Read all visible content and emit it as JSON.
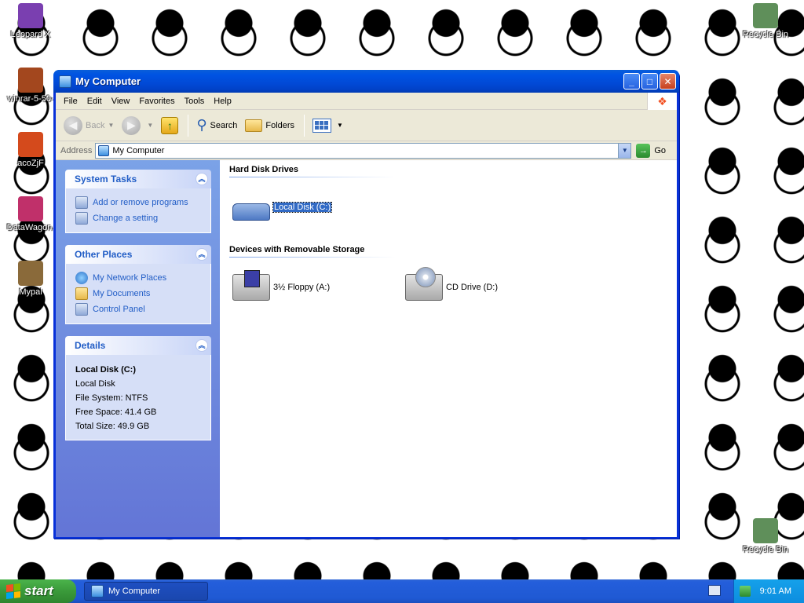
{
  "desktop": {
    "icons": [
      {
        "label": "Leopard X",
        "color": "#7a3fb0"
      },
      {
        "label": "winrar-5-50-",
        "color": "#a3471e"
      },
      {
        "label": "acoZjF",
        "color": "#d44a1c"
      },
      {
        "label": "DataWagon.",
        "color": "#c0306a"
      },
      {
        "label": "Mypal",
        "color": "#8a6a3a"
      },
      {
        "label": "Recycle Bin",
        "color": "#5f8f5a"
      },
      {
        "label": "Recycle Bin",
        "color": "#5f8f5a"
      }
    ]
  },
  "window": {
    "title": "My Computer",
    "buttons": {
      "minimize": "_",
      "maximize": "□",
      "close": "✕"
    },
    "menu": [
      "File",
      "Edit",
      "View",
      "Favorites",
      "Tools",
      "Help"
    ],
    "toolbar": {
      "back": "Back",
      "search": "Search",
      "folders": "Folders"
    },
    "address": {
      "label": "Address",
      "value": "My Computer",
      "go": "Go"
    }
  },
  "taskpane": {
    "system_tasks": {
      "title": "System Tasks",
      "items": [
        "Add or remove programs",
        "Change a setting"
      ]
    },
    "other_places": {
      "title": "Other Places",
      "items": [
        "My Network Places",
        "My Documents",
        "Control Panel"
      ]
    },
    "details": {
      "title": "Details",
      "name": "Local Disk (C:)",
      "type": "Local Disk",
      "file_system": "File System: NTFS",
      "free_space": "Free Space: 41.4 GB",
      "total_size": "Total Size: 49.9 GB"
    }
  },
  "content": {
    "hard_disks": {
      "title": "Hard Disk Drives",
      "items": [
        "Local Disk (C:)"
      ]
    },
    "removable": {
      "title": "Devices with Removable Storage",
      "items": [
        "3½ Floppy (A:)",
        "CD Drive (D:)"
      ]
    }
  },
  "taskbar": {
    "start": "start",
    "open_window": "My Computer",
    "clock": "9:01 AM"
  }
}
